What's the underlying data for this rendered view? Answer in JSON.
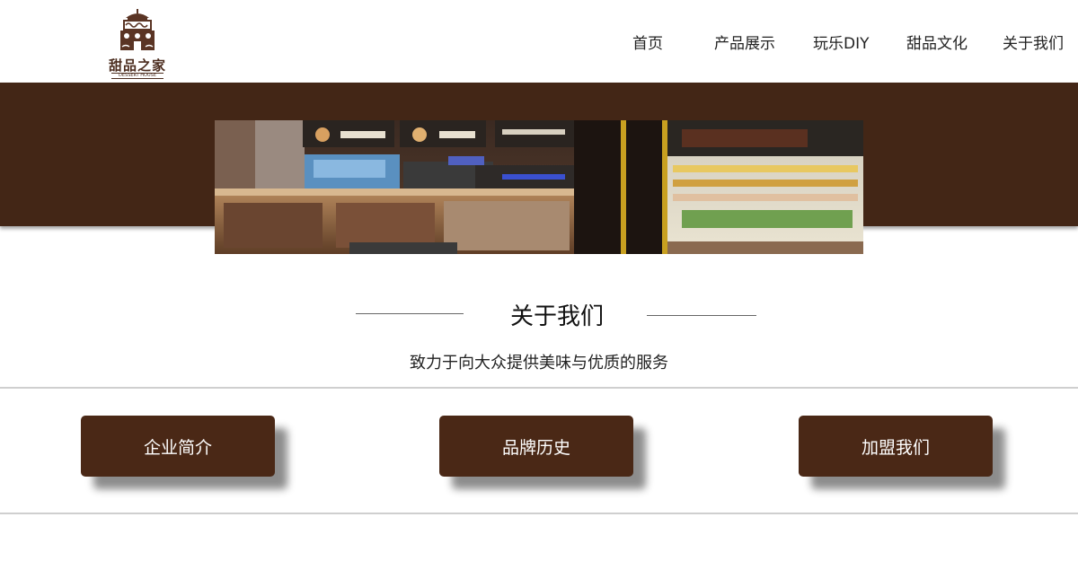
{
  "logo": {
    "name": "甜品之家",
    "tagline": "DESSERT HOUSE"
  },
  "nav": {
    "items": [
      {
        "label": "首页"
      },
      {
        "label": "产品展示"
      },
      {
        "label": "玩乐DIY"
      },
      {
        "label": "甜品文化"
      },
      {
        "label": "关于我们"
      }
    ]
  },
  "about": {
    "title": "关于我们",
    "subtitle": "致力于向大众提供美味与优质的服务"
  },
  "cards": [
    {
      "label": "企业简介"
    },
    {
      "label": "品牌历史"
    },
    {
      "label": "加盟我们"
    }
  ],
  "colors": {
    "brand_brown": "#432616",
    "button_brown": "#4a2816"
  }
}
